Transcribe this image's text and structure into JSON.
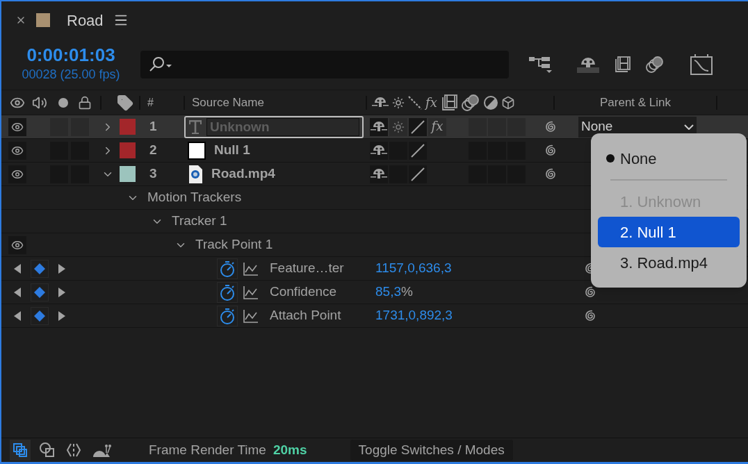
{
  "comp": {
    "title": "Road",
    "color": "#a89070"
  },
  "timecode": "0:00:01:03",
  "frame_info": "00028 (25.00 fps)",
  "columns": {
    "number": "#",
    "source_name": "Source Name",
    "fx": "fx",
    "parent": "Parent & Link"
  },
  "layers": [
    {
      "number": "1",
      "name": "Unknown",
      "kind": "text",
      "color": "#a3262a",
      "expanded": false,
      "selected": true,
      "renaming": true,
      "collapse": true,
      "fx": "fx",
      "parent": "None"
    },
    {
      "number": "2",
      "name": "Null 1",
      "kind": "null",
      "color": "#a3262a",
      "expanded": false,
      "selected": false,
      "renaming": false,
      "collapse": false
    },
    {
      "number": "3",
      "name": "Road.mp4",
      "kind": "footage",
      "color": "#9cc4bd",
      "expanded": true,
      "selected": false,
      "renaming": false,
      "collapse": false
    }
  ],
  "tree": {
    "label": "Motion Trackers",
    "expanded": true,
    "children": [
      {
        "label": "Tracker 1",
        "expanded": true,
        "children": [
          {
            "label": "Track Point 1",
            "expanded": true,
            "visible": true,
            "properties": [
              {
                "name": "Feature…ter",
                "value": "1157,0,636,3"
              },
              {
                "name": "Confidence",
                "value": "85,3",
                "unit": "%"
              },
              {
                "name": "Attach Point",
                "value": "1731,0,892,3"
              }
            ]
          }
        ]
      }
    ]
  },
  "parent_menu": {
    "items": [
      {
        "label": "None",
        "checked": true,
        "disabled": false,
        "selected": false
      },
      {
        "label": "1. Unknown",
        "checked": false,
        "disabled": true,
        "selected": false
      },
      {
        "label": "2. Null 1",
        "checked": false,
        "disabled": false,
        "selected": true
      },
      {
        "label": "3. Road.mp4",
        "checked": false,
        "disabled": false,
        "selected": false
      }
    ]
  },
  "status_bar": {
    "render_label": "Frame Render Time",
    "render_time": "20ms",
    "toggle": "Toggle Switches / Modes"
  }
}
